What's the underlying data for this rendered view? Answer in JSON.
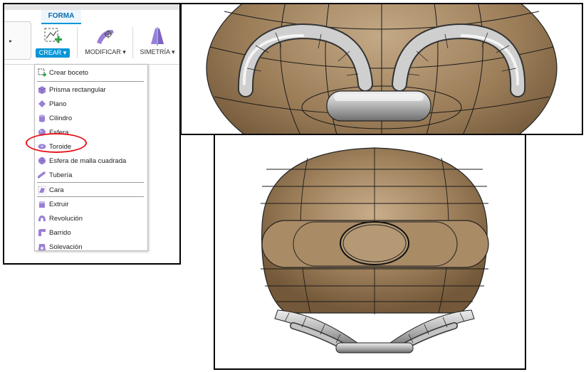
{
  "ribbon": {
    "tab_label": "FORMA",
    "tools": {
      "crear": "CREAR ▾",
      "modificar": "MODIFICAR ▾",
      "simetria": "SIMETRÍA ▾"
    }
  },
  "create_menu": {
    "items": [
      {
        "label": "Crear boceto",
        "icon": "sketch-icon"
      },
      {
        "label": "Prisma rectangular",
        "icon": "box-icon"
      },
      {
        "label": "Plano",
        "icon": "plane-icon"
      },
      {
        "label": "Cilindro",
        "icon": "cylinder-icon"
      },
      {
        "label": "Esfera",
        "icon": "sphere-icon"
      },
      {
        "label": "Toroide",
        "icon": "torus-icon"
      },
      {
        "label": "Esfera de malla cuadrada",
        "icon": "quadball-icon"
      },
      {
        "label": "Tubería",
        "icon": "pipe-icon"
      },
      {
        "label": "Cara",
        "icon": "face-icon"
      },
      {
        "label": "Extruir",
        "icon": "extrude-icon"
      },
      {
        "label": "Revolución",
        "icon": "revolve-icon"
      },
      {
        "label": "Barrido",
        "icon": "sweep-icon"
      },
      {
        "label": "Solevación",
        "icon": "loft-icon"
      }
    ],
    "highlighted_item": "Toroide"
  },
  "colors": {
    "accent": "#0696d7",
    "highlight_circle": "#e8141b",
    "body_brown": "#9a7c58",
    "menu_icon_purple": "#9b7fd6"
  }
}
